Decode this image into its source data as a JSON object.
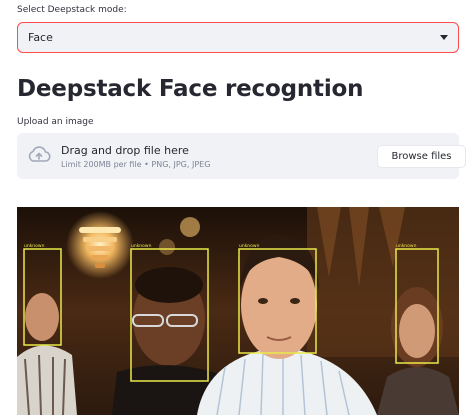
{
  "mode_select": {
    "label": "Select Deepstack mode:",
    "value": "Face"
  },
  "page_title": "Deepstack Face recogntion",
  "uploader": {
    "label": "Upload an image",
    "drop_title": "Drag and drop file here",
    "limit_text": "Limit 200MB per file • PNG, JPG, JPEG",
    "browse_label": "Browse files"
  },
  "result_image": {
    "box_color": "#e9e94a",
    "faces": [
      {
        "label": "unknown"
      },
      {
        "label": "unknown"
      },
      {
        "label": "unknown"
      },
      {
        "label": "unknown"
      }
    ]
  },
  "colors": {
    "accent": "#ff4b4b",
    "panel_bg": "#f0f2f6",
    "text": "#262730"
  }
}
